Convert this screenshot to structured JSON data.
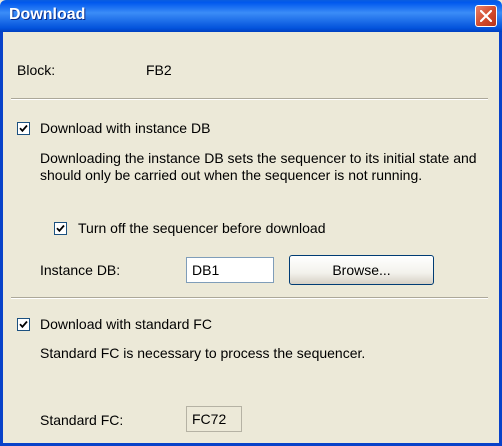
{
  "window": {
    "title": "Download"
  },
  "block": {
    "label": "Block:",
    "value": "FB2"
  },
  "instance_db": {
    "checkbox_label": "Download with instance DB",
    "checked": true,
    "description": "Downloading the instance DB sets the sequencer to its initial state and should only be carried out when the sequencer is not running.",
    "turn_off_label": "Turn off the sequencer before download",
    "turn_off_checked": true,
    "field_label": "Instance DB:",
    "field_value": "DB1",
    "browse_label": "Browse..."
  },
  "standard_fc": {
    "checkbox_label": "Download with standard FC",
    "checked": true,
    "description": "Standard FC is necessary to process the sequencer.",
    "field_label": "Standard FC:",
    "field_value": "FC72"
  },
  "colors": {
    "title_bar": "#0058ee",
    "close_button": "#d24a2b",
    "dialog_background": "#ece9d8"
  },
  "icons": {
    "close": "close-icon",
    "check": "checkmark-icon"
  }
}
